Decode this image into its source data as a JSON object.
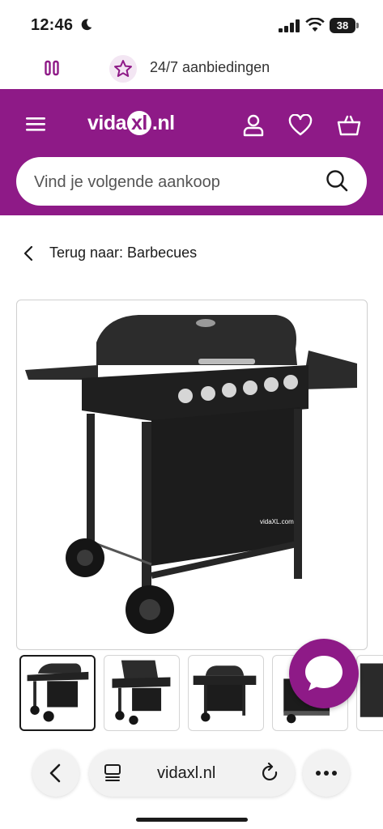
{
  "status_bar": {
    "time": "12:46",
    "battery": "38"
  },
  "promo": {
    "text": "24/7 aanbiedingen"
  },
  "header": {
    "logo_prefix": "vida",
    "logo_badge": "xl",
    "logo_suffix": ".nl",
    "search": {
      "placeholder": "Vind je volgende aankoop"
    }
  },
  "breadcrumb": {
    "text": "Terug naar: Barbecues"
  },
  "product": {
    "image_icon": "gas-barbecue-image",
    "thumbnail_count": 5
  },
  "browser": {
    "url": "vidaxl.nl"
  },
  "colors": {
    "brand": "#8e1a87",
    "brand_light": "#f3e6f3"
  }
}
